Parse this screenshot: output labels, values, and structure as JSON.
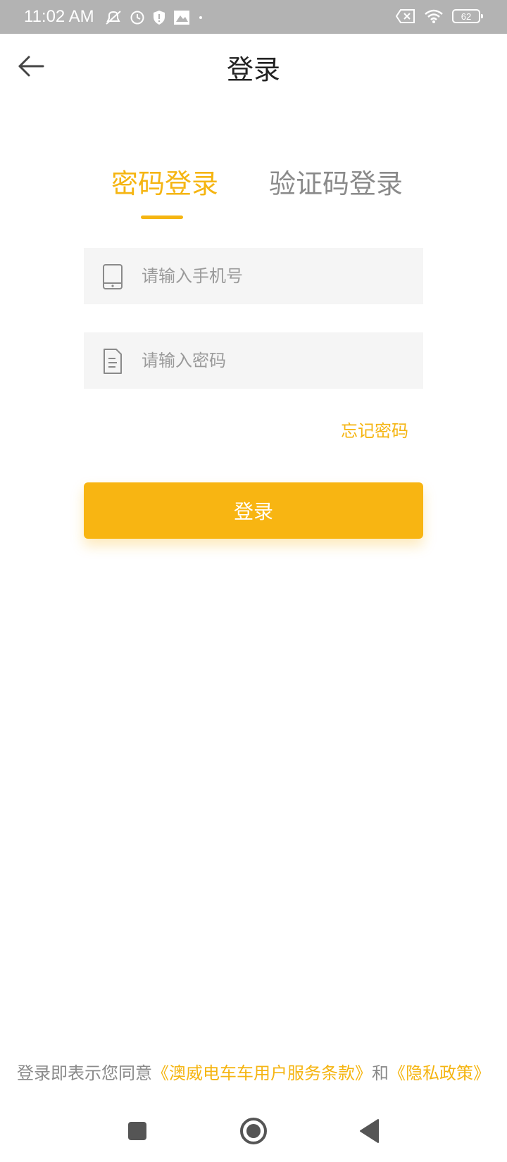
{
  "status_bar": {
    "time": "11:02 AM",
    "battery_level": "62",
    "icons_left": [
      "mute-icon",
      "alarm-icon",
      "shield-icon",
      "image-icon",
      "dot-icon"
    ],
    "icons_right": [
      "sim-x-icon",
      "wifi-icon",
      "battery-icon"
    ]
  },
  "header": {
    "title": "登录",
    "back_icon": "arrow-left-icon"
  },
  "tabs": [
    {
      "label": "密码登录",
      "active": true
    },
    {
      "label": "验证码登录",
      "active": false
    }
  ],
  "form": {
    "phone_placeholder": "请输入手机号",
    "phone_value": "",
    "password_placeholder": "请输入密码",
    "password_value": "",
    "phone_icon": "phone-icon",
    "password_icon": "document-icon",
    "forgot_label": "忘记密码",
    "login_label": "登录"
  },
  "agreement": {
    "prefix": "登录即表示您同意",
    "terms_label": "《澳威电车车用户服务条款》",
    "conjunction": "和",
    "privacy_label": "《隐私政策》"
  },
  "colors": {
    "accent": "#f8b512",
    "status_bar": "#b3b3b3",
    "input_bg": "#f5f5f5",
    "inactive_text": "#8a8a8a"
  },
  "nav_bar": {
    "icons": [
      "recent-apps-icon",
      "home-icon",
      "back-triangle-icon"
    ]
  }
}
